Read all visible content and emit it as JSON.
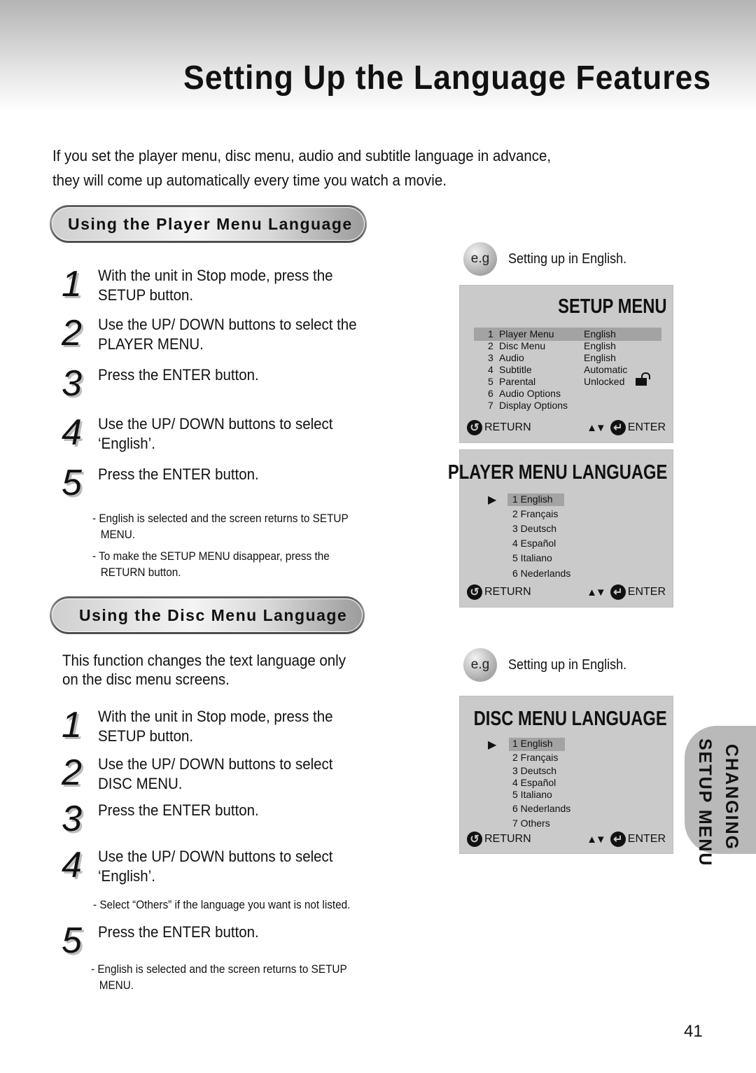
{
  "page": {
    "title": "Setting Up the Language Features",
    "intro_lines": [
      "If you set the player menu, disc menu, audio and subtitle language in advance,",
      "they will come up automatically every time you watch a movie."
    ],
    "page_number": "41",
    "side_tab": {
      "line1": "CHANGING",
      "line2": "SETUP MENU"
    }
  },
  "player_section": {
    "heading": "Using the Player Menu Language",
    "steps": [
      {
        "num": "1",
        "lines": [
          "With the unit in Stop mode, press the",
          "SETUP button."
        ]
      },
      {
        "num": "2",
        "lines": [
          "Use the UP/ DOWN  buttons to select the",
          "PLAYER MENU."
        ]
      },
      {
        "num": "3",
        "lines": [
          "Press the ENTER button."
        ]
      },
      {
        "num": "4",
        "lines": [
          "Use the UP/ DOWN  buttons to select",
          "‘English’."
        ]
      },
      {
        "num": "5",
        "lines": [
          "Press the ENTER button."
        ]
      }
    ],
    "notes": [
      {
        "line1": "- English is selected and the screen returns to SETUP",
        "line2": "MENU."
      },
      {
        "line1": "- To make the SETUP MENU disappear, press the",
        "line2": "RETURN button."
      }
    ]
  },
  "disc_section": {
    "heading": "Using the Disc Menu Language",
    "intro_lines": [
      "This function changes the text language only",
      "on the disc menu screens."
    ],
    "steps": [
      {
        "num": "1",
        "lines": [
          "With the unit in Stop mode, press the",
          "SETUP button."
        ]
      },
      {
        "num": "2",
        "lines": [
          "Use the UP/ DOWN  buttons to select",
          "DISC MENU."
        ]
      },
      {
        "num": "3",
        "lines": [
          "Press the ENTER button."
        ]
      },
      {
        "num": "4",
        "lines": [
          "Use the UP/ DOWN  buttons to select",
          "‘English’."
        ]
      },
      {
        "num": "5",
        "lines": [
          "Press the ENTER button."
        ]
      }
    ],
    "note_others": "- Select “Others” if the language you want is not listed.",
    "note_final": {
      "line1": "- English is selected and the screen returns to SETUP",
      "line2": "MENU."
    }
  },
  "examples": {
    "badge": "e.g",
    "caption": "Setting up in English."
  },
  "setup_menu": {
    "title": "SETUP MENU",
    "items": [
      {
        "num": "1",
        "label": "Player Menu",
        "value": "English",
        "selected": true
      },
      {
        "num": "2",
        "label": "Disc Menu",
        "value": "English"
      },
      {
        "num": "3",
        "label": "Audio",
        "value": "English"
      },
      {
        "num": "4",
        "label": "Subtitle",
        "value": "Automatic"
      },
      {
        "num": "5",
        "label": "Parental",
        "value": "Unlocked",
        "icon": "unlocked-padlock-icon"
      },
      {
        "num": "6",
        "label": "Audio Options",
        "value": ""
      },
      {
        "num": "7",
        "label": "Display Options",
        "value": ""
      }
    ],
    "return_label": "RETURN",
    "enter_label": "ENTER"
  },
  "player_menu_language": {
    "title": "PLAYER MENU LANGUAGE",
    "options": [
      "1  English",
      "2  Français",
      "3  Deutsch",
      "4  Español",
      "5  Italiano",
      "6  Nederlands"
    ],
    "selected_index": 0,
    "return_label": "RETURN",
    "enter_label": "ENTER"
  },
  "disc_menu_language": {
    "title": "DISC MENU LANGUAGE",
    "options": [
      "1  English",
      "2  Français",
      "3  Deutsch",
      "4  Español",
      "5  Italiano",
      "6  Nederlands",
      "7 Others"
    ],
    "selected_index": 0,
    "return_label": "RETURN",
    "enter_label": "ENTER"
  },
  "colors": {
    "osd_background": "#cacaca",
    "osd_highlight": "#a3a3a3",
    "side_tab": "#b9b9b9"
  }
}
